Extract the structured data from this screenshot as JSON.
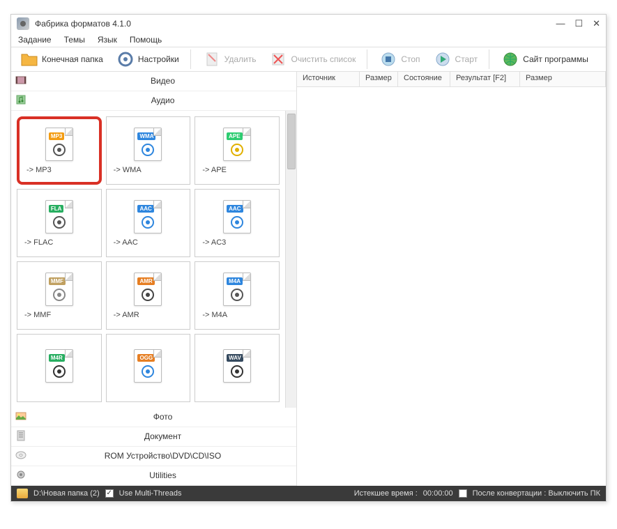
{
  "title": "Фабрика форматов 4.1.0",
  "menu": {
    "task": "Задание",
    "themes": "Темы",
    "lang": "Язык",
    "help": "Помощь"
  },
  "toolbar": {
    "output_folder": "Конечная папка",
    "settings": "Настройки",
    "delete": "Удалить",
    "clear": "Очистить список",
    "stop": "Стоп",
    "start": "Старт",
    "site": "Сайт программы"
  },
  "categories": {
    "video": "Видео",
    "audio": "Аудио",
    "photo": "Фото",
    "doc": "Документ",
    "rom": "ROM Устройство\\DVD\\CD\\ISO",
    "utils": "Utilities"
  },
  "formats": [
    {
      "tag": "MP3",
      "tag_bg": "#f39c12",
      "label": "-> MP3",
      "glyph_color": "#555"
    },
    {
      "tag": "WMA",
      "tag_bg": "#2e86de",
      "label": "-> WMA",
      "glyph_color": "#2e86de"
    },
    {
      "tag": "APE",
      "tag_bg": "#2ecc71",
      "label": "-> APE",
      "glyph_color": "#e1b000"
    },
    {
      "tag": "FLA",
      "tag_bg": "#27ae60",
      "label": "-> FLAC",
      "glyph_color": "#555"
    },
    {
      "tag": "AAC",
      "tag_bg": "#2e86de",
      "label": "-> AAC",
      "glyph_color": "#2e86de"
    },
    {
      "tag": "AAC",
      "tag_bg": "#2e86de",
      "label": "-> AC3",
      "glyph_color": "#2e86de"
    },
    {
      "tag": "MMF",
      "tag_bg": "#c0a060",
      "label": "-> MMF",
      "glyph_color": "#888"
    },
    {
      "tag": "AMR",
      "tag_bg": "#e67e22",
      "label": "-> AMR",
      "glyph_color": "#444"
    },
    {
      "tag": "M4A",
      "tag_bg": "#2e86de",
      "label": "-> M4A",
      "glyph_color": "#555"
    },
    {
      "tag": "M4R",
      "tag_bg": "#27ae60",
      "label": "",
      "glyph_color": "#333"
    },
    {
      "tag": "OGG",
      "tag_bg": "#e67e22",
      "label": "",
      "glyph_color": "#2e86de"
    },
    {
      "tag": "WAV",
      "tag_bg": "#34495e",
      "label": "",
      "glyph_color": "#333"
    }
  ],
  "columns": {
    "source": "Источник",
    "size": "Размер",
    "state": "Состояние",
    "result": "Результат [F2]",
    "size2": "Размер"
  },
  "status": {
    "path": "D:\\Новая папка (2)",
    "multithread": "Use Multi-Threads",
    "multithread_checked": true,
    "elapsed_label": "Истекшее время :",
    "elapsed_value": "00:00:00",
    "shutdown": "После конвертации : Выключить ПК",
    "shutdown_checked": false
  }
}
